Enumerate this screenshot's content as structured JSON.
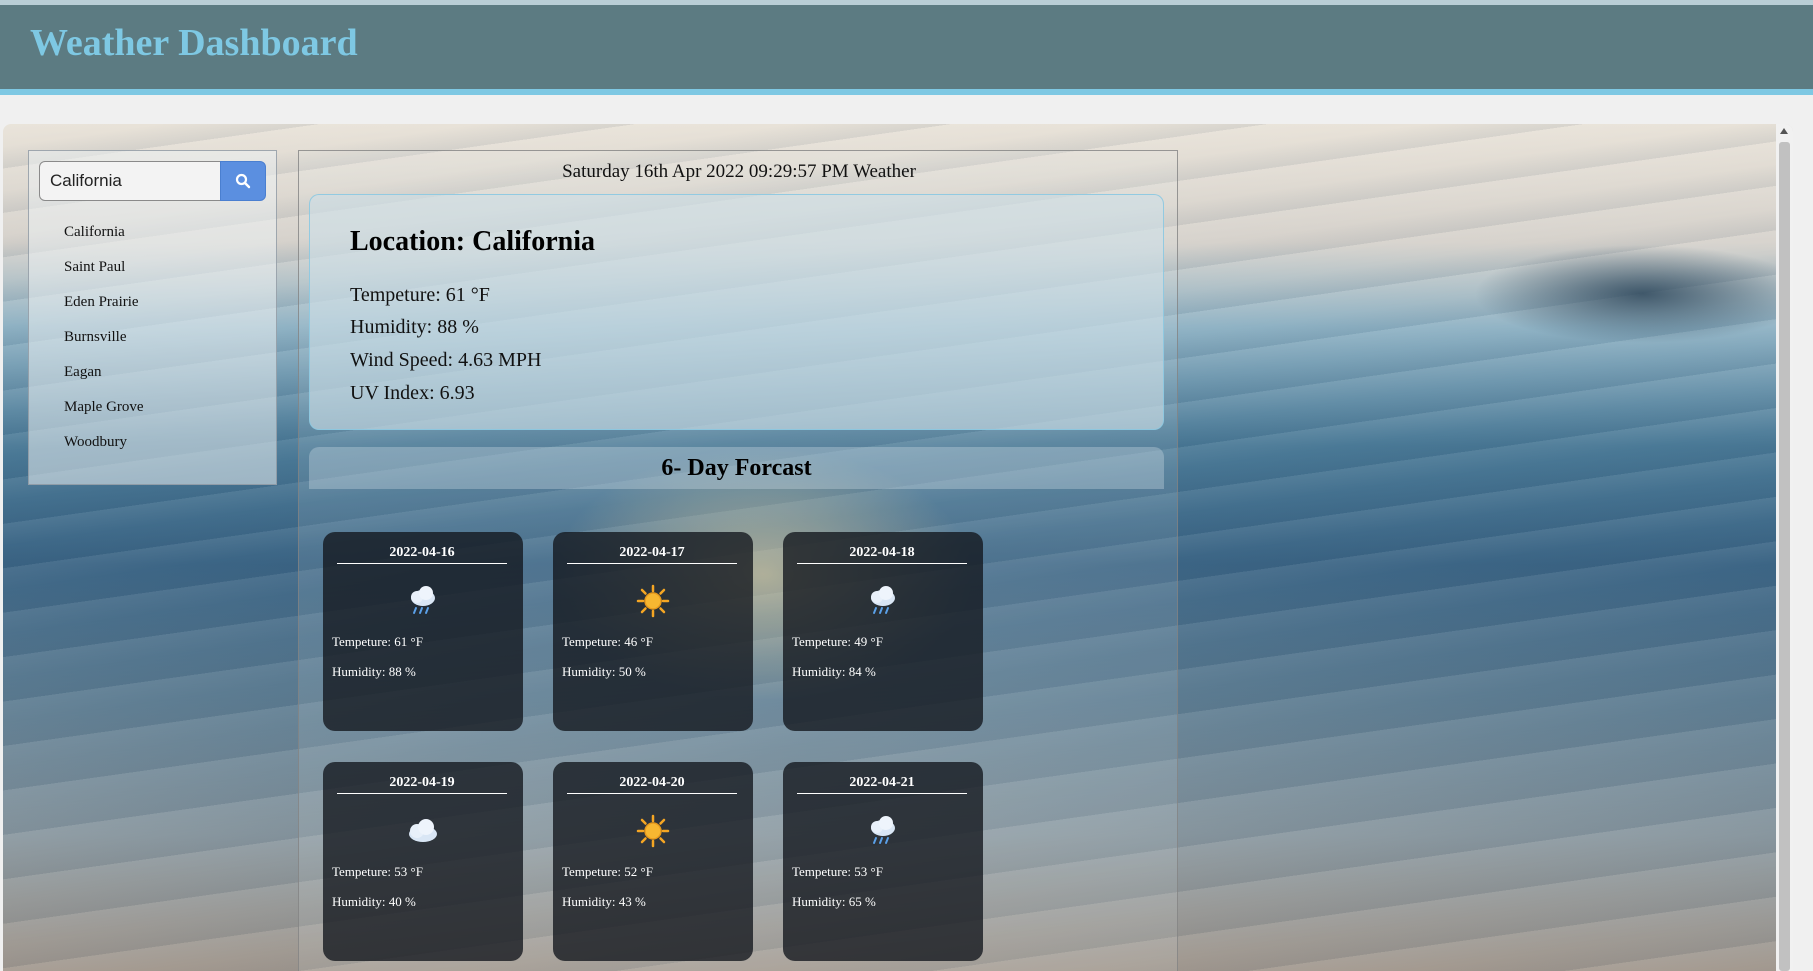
{
  "header": {
    "title": "Weather Dashboard"
  },
  "search": {
    "value": "California",
    "placeholder": ""
  },
  "history": [
    "California",
    "Saint Paul",
    "Eden Prairie",
    "Burnsville",
    "Eagan",
    "Maple Grove",
    "Woodbury"
  ],
  "current": {
    "datetime": "Saturday 16th Apr 2022 09:29:57 PM Weather",
    "location": "Location: California",
    "temperature": "Tempeture: 61 °F",
    "humidity": "Humidity: 88 %",
    "wind": "Wind Speed: 4.63 MPH",
    "uv": "UV Index: 6.93"
  },
  "forecast": {
    "title": "6- Day Forcast",
    "days": [
      {
        "date": "2022-04-16",
        "icon": "rain-cloud-icon",
        "temp": "Tempeture: 61 °F",
        "humidity": "Humidity: 88 %"
      },
      {
        "date": "2022-04-17",
        "icon": "sun-icon",
        "temp": "Tempeture: 46 °F",
        "humidity": "Humidity: 50 %"
      },
      {
        "date": "2022-04-18",
        "icon": "rain-cloud-icon",
        "temp": "Tempeture: 49 °F",
        "humidity": "Humidity: 84 %"
      },
      {
        "date": "2022-04-19",
        "icon": "cloud-icon",
        "temp": "Tempeture: 53 °F",
        "humidity": "Humidity: 40 %"
      },
      {
        "date": "2022-04-20",
        "icon": "sun-icon",
        "temp": "Tempeture: 52 °F",
        "humidity": "Humidity: 43 %"
      },
      {
        "date": "2022-04-21",
        "icon": "rain-cloud-icon",
        "temp": "Tempeture: 53 °F",
        "humidity": "Humidity: 65 %"
      }
    ]
  },
  "colors": {
    "header_bg": "#5c7b82",
    "accent": "#7ec8e3",
    "search_button": "#5b8fe0",
    "card_bg": "#12161c"
  }
}
